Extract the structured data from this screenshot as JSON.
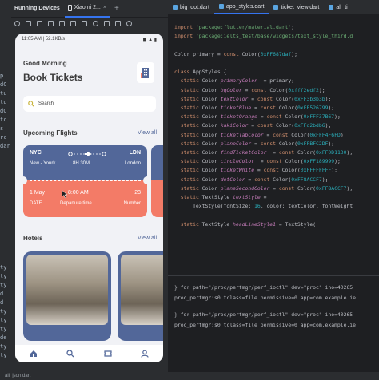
{
  "running_devices": {
    "title": "Running Devices",
    "tab_label": "Xiaomi 2...",
    "add": "+"
  },
  "phone": {
    "status_time": "11:05 AM | 52.1KB/s",
    "status_right": "◼ ▲ ▮",
    "greeting": "Good Morning",
    "title": "Book Tickets",
    "search_placeholder": "Search",
    "upcoming_title": "Upcoming Flights",
    "view_all": "View all",
    "ticket": {
      "from_code": "NYC",
      "from_name": "New - Yourk",
      "duration": "8H 30M",
      "to_code": "LDN",
      "to_name": "London",
      "date_value": "1 May",
      "date_label": "DATE",
      "time_value": "8:00 AM",
      "time_label": "Departure time",
      "number_value": "23",
      "number_label": "Number"
    },
    "hotels_title": "Hotels",
    "hotels_view_all": "View all"
  },
  "left_code": [
    "p",
    "dC",
    "tu",
    "tu",
    "dC",
    "tc",
    "s",
    "rc",
    "dar"
  ],
  "left_lower": [
    "ty",
    "ty",
    "ty",
    "d",
    "d",
    "ty",
    "ty",
    "ty",
    "de",
    "ty",
    "ty"
  ],
  "editor": {
    "tabs": [
      {
        "label": "big_dot.dart",
        "active": false
      },
      {
        "label": "app_styles.dart",
        "active": true
      },
      {
        "label": "ticket_view.dart",
        "active": false
      },
      {
        "label": "all_ti",
        "active": false
      }
    ]
  },
  "terminal": {
    "lines": [
      "} for path=\"/proc/perfmgr/perf_ioctl\" dev=\"proc\" ino=40265",
      "proc_perfmgr:s0 tclass=file permissive=0 app=com.example.ie",
      "} for path=\"/proc/perfmgr/perf_ioctl\" dev=\"proc\" ino=40265",
      "proc_perfmgr:s0 tclass=file permissive=0 app=com.example.ie"
    ]
  },
  "statusbar": {
    "file": "all_json.dart"
  },
  "colors": {
    "primary": "#526799",
    "orange": "#F37B67",
    "bg": "#F1F2F6"
  }
}
